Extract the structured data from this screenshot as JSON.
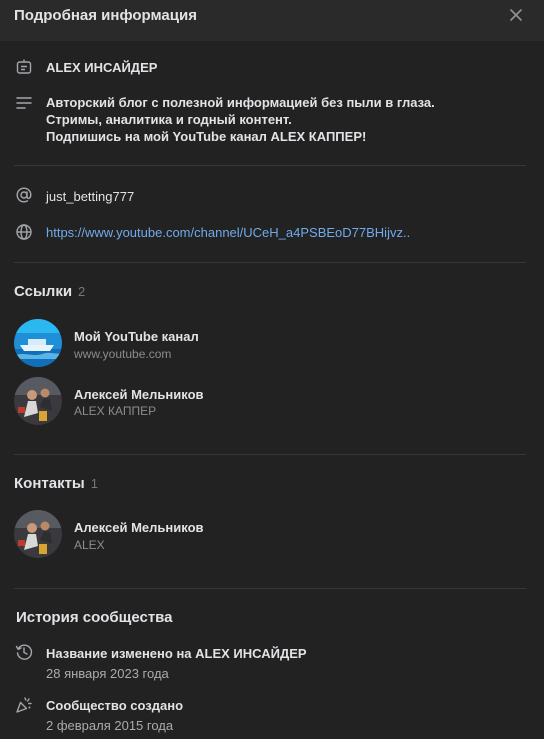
{
  "header": {
    "title": "Подробная информация"
  },
  "info": {
    "name": "ALEX ИНСАЙДЕР",
    "description": [
      "Авторский блог с полезной информацией без пыли в глаза.",
      "Стримы, аналитика и годный контент.",
      "Подпишись на мой YouTube канал ALEX КАППЕР!"
    ],
    "username": "just_betting777",
    "website": "https://www.youtube.com/channel/UCeH_a4PSBEoD77BHijvz.."
  },
  "links": {
    "title": "Ссылки",
    "count": "2",
    "items": [
      {
        "name": "Мой YouTube канал",
        "sub": "www.youtube.com"
      },
      {
        "name": "Алексей Мельников",
        "sub": "ALEX КАППЕР"
      }
    ]
  },
  "contacts": {
    "title": "Контакты",
    "count": "1",
    "items": [
      {
        "name": "Алексей Мельников",
        "sub": "ALEX"
      }
    ]
  },
  "history": {
    "title": "История сообщества",
    "items": [
      {
        "title": "Название изменено на ALEX ИНСАЙДЕР",
        "date": "28 января 2023 года",
        "icon": "history-icon"
      },
      {
        "title": "Сообщество создано",
        "date": "2 февраля 2015 года",
        "icon": "party-icon"
      }
    ]
  },
  "colors": {
    "background": "#222222",
    "header": "#2a2a2a",
    "link": "#71aaeb",
    "muted": "#76787a"
  }
}
